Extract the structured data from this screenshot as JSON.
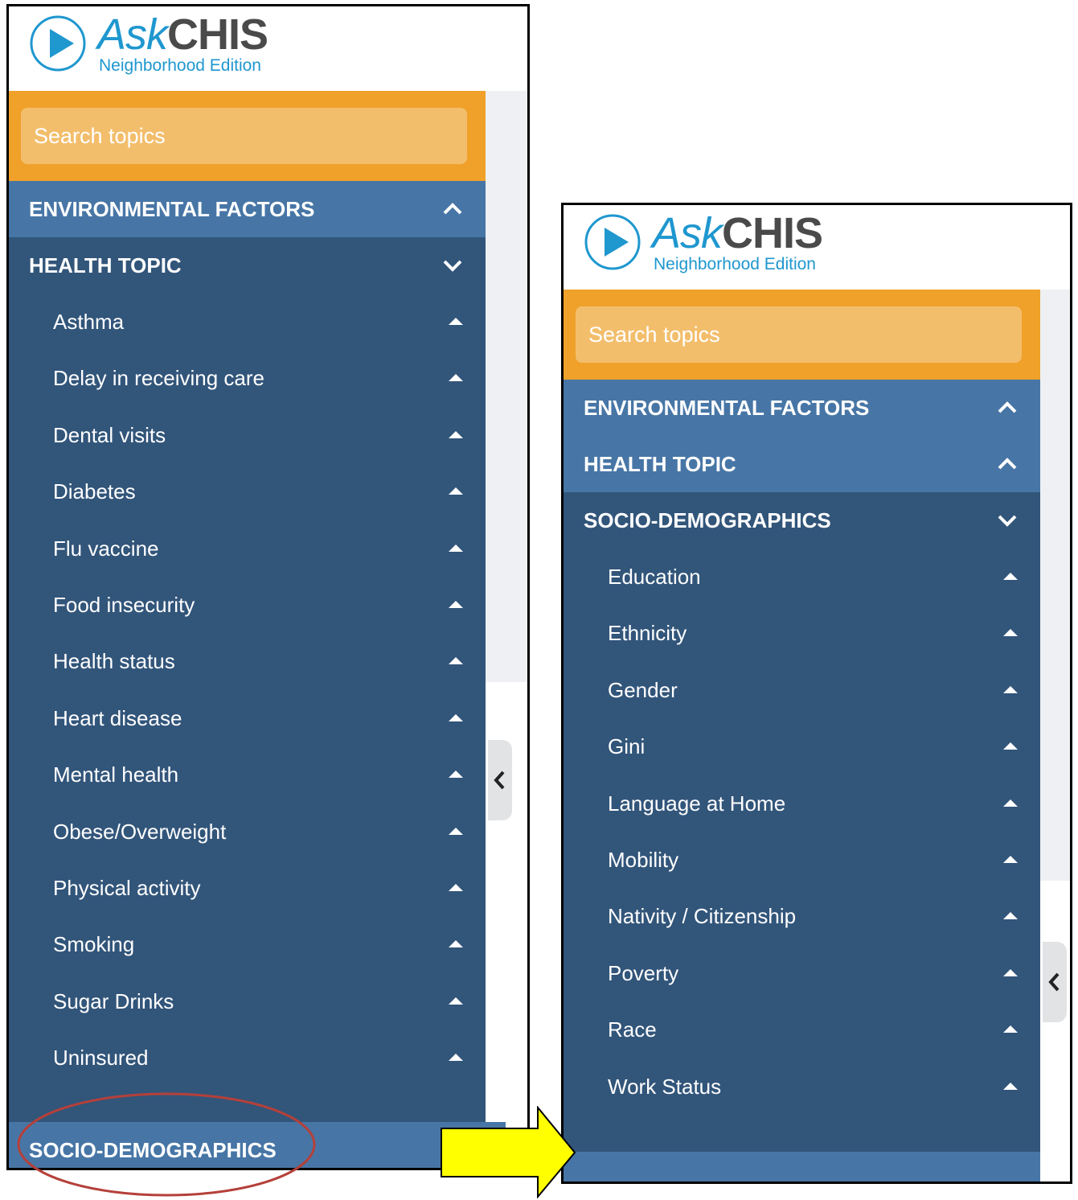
{
  "left_panel": {
    "logo": {
      "ask": "Ask",
      "chis": "CHIS",
      "edition": "Neighborhood Edition"
    },
    "search": {
      "placeholder": "Search topics"
    },
    "sections": {
      "environmental": "ENVIRONMENTAL FACTORS",
      "health_topic": "HEALTH TOPIC",
      "socio": "SOCIO-DEMOGRAPHICS"
    },
    "health_items": [
      "Asthma",
      "Delay in receiving care",
      "Dental visits",
      "Diabetes",
      "Flu vaccine",
      "Food insecurity",
      "Health status",
      "Heart disease",
      "Mental health",
      "Obese/Overweight",
      "Physical activity",
      "Smoking",
      "Sugar Drinks",
      "Uninsured"
    ]
  },
  "right_panel": {
    "logo": {
      "ask": "Ask",
      "chis": "CHIS",
      "edition": "Neighborhood Edition"
    },
    "search": {
      "placeholder": "Search topics"
    },
    "sections": {
      "environmental": "ENVIRONMENTAL FACTORS",
      "health_topic": "HEALTH TOPIC",
      "socio": "SOCIO-DEMOGRAPHICS"
    },
    "socio_items": [
      "Education",
      "Ethnicity",
      "Gender",
      "Gini",
      "Language at Home",
      "Mobility",
      "Nativity / Citizenship",
      "Poverty",
      "Race",
      "Work Status"
    ]
  },
  "colors": {
    "accent_orange": "#f0a12a",
    "nav_dark": "#32557a",
    "nav_light": "#4776a6",
    "brand_blue": "#1f97cf",
    "annotation_arrow": "#ffff00",
    "annotation_ellipse": "#b5403a"
  }
}
